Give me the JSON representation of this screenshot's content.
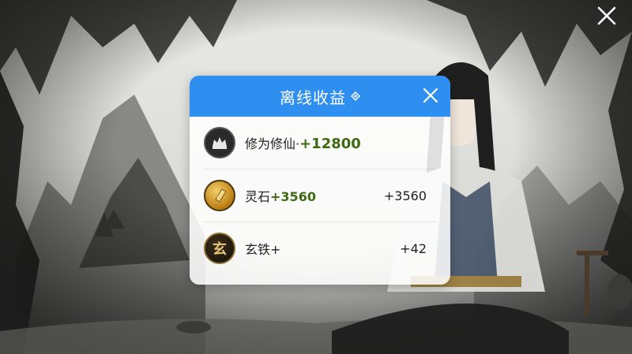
{
  "panel": {
    "title": "离线收益",
    "rows": [
      {
        "icon": "crown-icon",
        "name": "修为修仙·",
        "gain": "+12800",
        "right": ""
      },
      {
        "icon": "spirit-stone-icon",
        "name": "灵石",
        "gain": "+3560",
        "right": "+3560"
      },
      {
        "icon": "black-iron-icon",
        "icon_text": "玄",
        "name": "玄铁+",
        "gain": "",
        "right": "+42"
      }
    ]
  },
  "colors": {
    "header": "#2f8ff0",
    "gain": "#3d6a12"
  }
}
